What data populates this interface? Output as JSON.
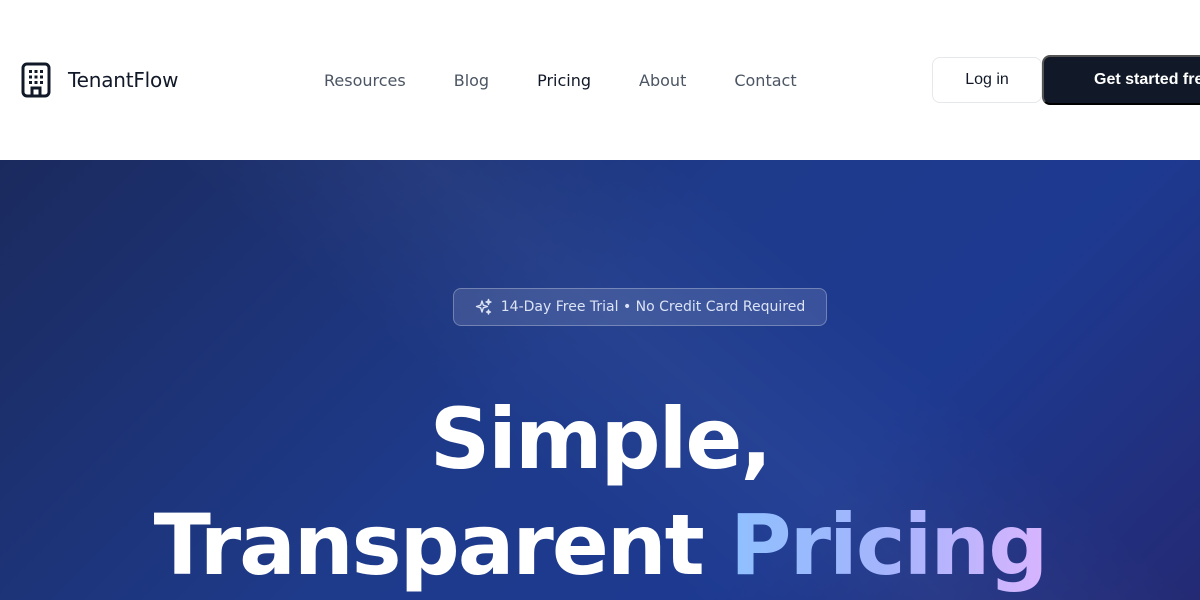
{
  "brand": {
    "name": "TenantFlow",
    "icon": "building-icon"
  },
  "nav": {
    "links": [
      {
        "label": "Resources"
      },
      {
        "label": "Blog"
      },
      {
        "label": "Pricing",
        "active": true
      },
      {
        "label": "About"
      },
      {
        "label": "Contact"
      }
    ],
    "login_label": "Log in",
    "cta_label": "Get started free"
  },
  "hero": {
    "badge_icon": "sparkles-icon",
    "badge_text": "14-Day Free Trial • No Credit Card Required",
    "title_line1": "Simple,",
    "title_line2_plain": "Transparent",
    "title_line2_accent": "Pricing"
  },
  "colors": {
    "nav_background": "#ffffff",
    "cta_background": "#111827",
    "hero_gradient_start": "#1b2a5e",
    "hero_gradient_end": "#1e3a8a",
    "accent_gradient": [
      "#8fc0ff",
      "#a5b4fc",
      "#d8b4fe"
    ]
  }
}
